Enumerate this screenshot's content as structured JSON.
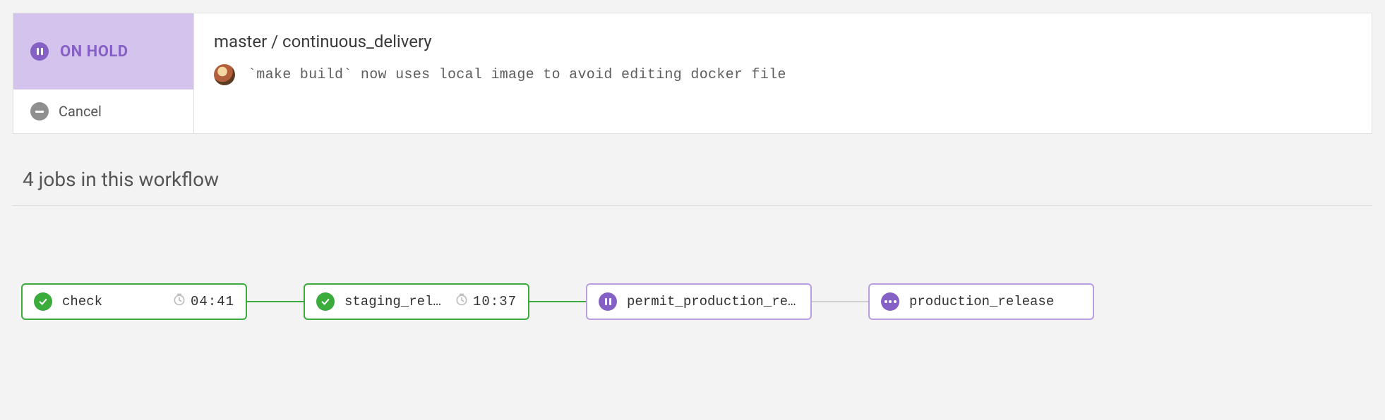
{
  "status": {
    "label": "ON HOLD",
    "cancel_label": "Cancel"
  },
  "breadcrumb": {
    "branch": "master",
    "workflow": "continuous_delivery",
    "combined": "master / continuous_delivery"
  },
  "commit": {
    "message": "`make build` now uses local image to avoid editing docker file"
  },
  "section_title": "4 jobs in this workflow",
  "jobs": [
    {
      "name": "check",
      "state": "success",
      "time": "04:41"
    },
    {
      "name": "staging_rele…",
      "state": "success",
      "time": "10:37"
    },
    {
      "name": "permit_production_re…",
      "state": "hold",
      "time": ""
    },
    {
      "name": "production_release",
      "state": "pending",
      "time": ""
    }
  ],
  "colors": {
    "hold_bg": "#d4c3ec",
    "hold_accent": "#8661c5",
    "success": "#3bab3b",
    "gray": "#cfcfcf"
  }
}
